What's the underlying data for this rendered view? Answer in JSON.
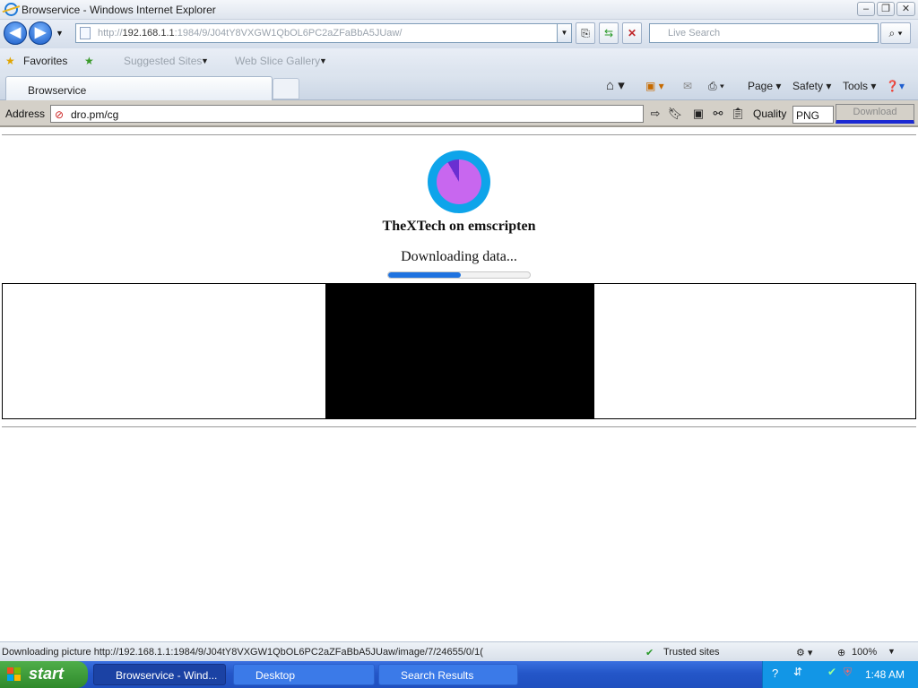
{
  "window": {
    "title": "Browservice - Windows Internet Explorer",
    "minimize": "–",
    "restore": "❐",
    "close": "✕"
  },
  "nav": {
    "back_icon": "◀",
    "forward_icon": "▶",
    "address_prefix": "http://",
    "address_host": "192.168.1.1",
    "address_rest": ":1984/9/J04tY8VXGW1QbOL6PC2aZFaBbA5JUaw/",
    "search_placeholder": "Live Search"
  },
  "favorites": {
    "favorites_label": "Favorites",
    "suggested_label": "Suggested Sites",
    "webslice_label": "Web Slice Gallery"
  },
  "tabs": {
    "active_label": "Browservice",
    "commands": {
      "page": "Page",
      "safety": "Safety",
      "tools": "Tools"
    }
  },
  "plugin": {
    "address_label": "Address",
    "url_value": "dro.pm/cg",
    "quality_label": "Quality",
    "quality_value": "PNG",
    "download_label": "Download"
  },
  "page": {
    "app_title": "TheXTech on emscripten",
    "status_text": "Downloading data...",
    "progress_fraction": 0.51
  },
  "status_bar": {
    "message": "Downloading picture http://192.168.1.1:1984/9/J04tY8VXGW1QbOL6PC2aZFaBbA5JUaw/image/7/24655/0/1(",
    "zone": "Trusted sites",
    "zoom": "100%"
  },
  "taskbar": {
    "start_label": "start",
    "tasks": [
      {
        "label": "Browservice - Wind..."
      },
      {
        "label": "Desktop"
      },
      {
        "label": "Search Results"
      }
    ],
    "clock": "1:48 AM"
  },
  "colors": {
    "progress_fill": "#1f73e0",
    "logo_outer": "#0ea4ea",
    "logo_inner": "#c867ef",
    "download_underline": "#1c2ad2"
  },
  "icons": [
    "ie-icon",
    "back-icon",
    "forward-icon",
    "refresh-icon",
    "stop-icon",
    "search-icon",
    "star-icon",
    "home-icon",
    "rss-icon",
    "print-icon",
    "help-icon",
    "trusted-check-icon",
    "zoom-icon",
    "windows-flag-icon"
  ]
}
